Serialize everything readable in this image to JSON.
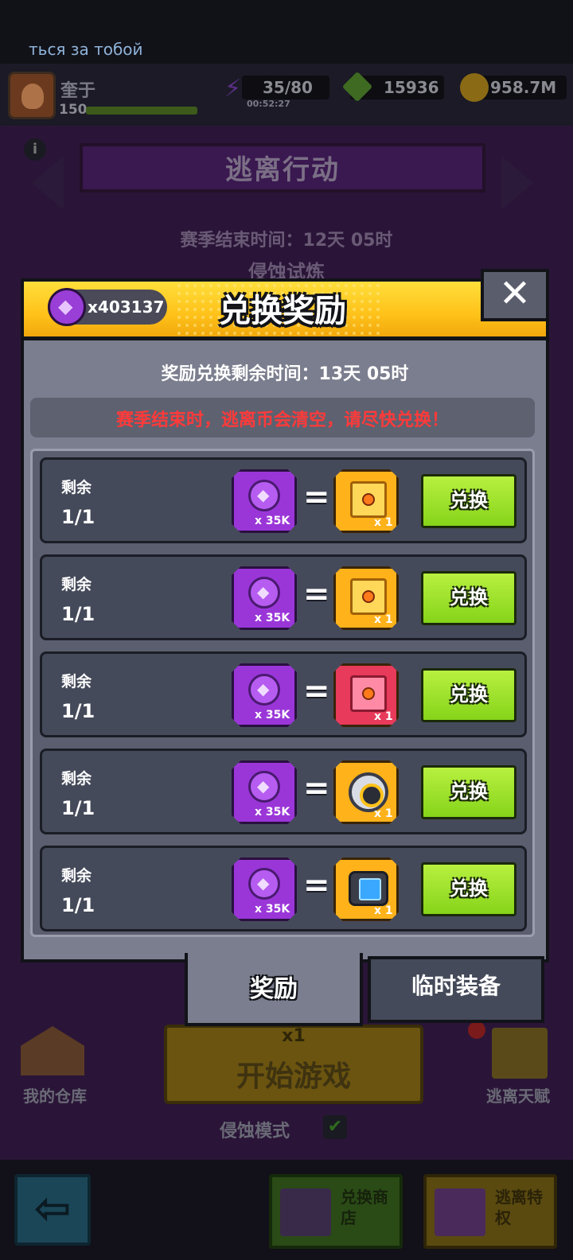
{
  "status": {
    "marquee": "ться за тобой",
    "player_name": "奎于",
    "player_level": "150",
    "energy": "35/80",
    "energy_timer": "00:52:27",
    "gems": "15936",
    "coins": "958.7M"
  },
  "background": {
    "event_title": "逃离行动",
    "season_end": "赛季结束时间：12天 05时",
    "erosion_trial": "侵蚀试炼",
    "warehouse": "我的仓库",
    "talent": "逃离天赋",
    "start_cost": "x1",
    "start_game": "开始游戏",
    "mode": "侵蚀模式",
    "shop_label": "兑换商店",
    "privilege_label": "逃离特权"
  },
  "modal": {
    "title": "兑换奖励",
    "currency_count": "x403137",
    "close": "✕",
    "remaining_time": "奖励兑换剩余时间：13天 05时",
    "warning": "赛季结束时，逃离币会清空，请尽快兑换！",
    "rows": [
      {
        "remain_label": "剩余",
        "remain_value": "1/1",
        "cost": "x 35K",
        "reward_qty": "x 1",
        "reward_icon": "orange-chest-icon",
        "button": "兑换"
      },
      {
        "remain_label": "剩余",
        "remain_value": "1/1",
        "cost": "x 35K",
        "reward_qty": "x 1",
        "reward_icon": "orange-chest-star-icon",
        "button": "兑换"
      },
      {
        "remain_label": "剩余",
        "remain_value": "1/1",
        "cost": "x 35K",
        "reward_qty": "x 1",
        "reward_icon": "red-chest-icon",
        "button": "兑换"
      },
      {
        "remain_label": "剩余",
        "remain_value": "1/1",
        "cost": "x 35K",
        "reward_qty": "x 1",
        "reward_icon": "gear-core-icon",
        "button": "兑换"
      },
      {
        "remain_label": "剩余",
        "remain_value": "1/1",
        "cost": "x 35K",
        "reward_qty": "x 1",
        "reward_icon": "device-module-icon",
        "button": "兑换"
      }
    ],
    "tabs": [
      {
        "label": "奖励",
        "active": true
      },
      {
        "label": "临时装备",
        "active": false
      }
    ]
  },
  "colors": {
    "header_yellow": "#ffc21a",
    "redeem_green": "#86d41a",
    "warning_red": "#ff3a3a",
    "currency_purple": "#9a36d8"
  }
}
